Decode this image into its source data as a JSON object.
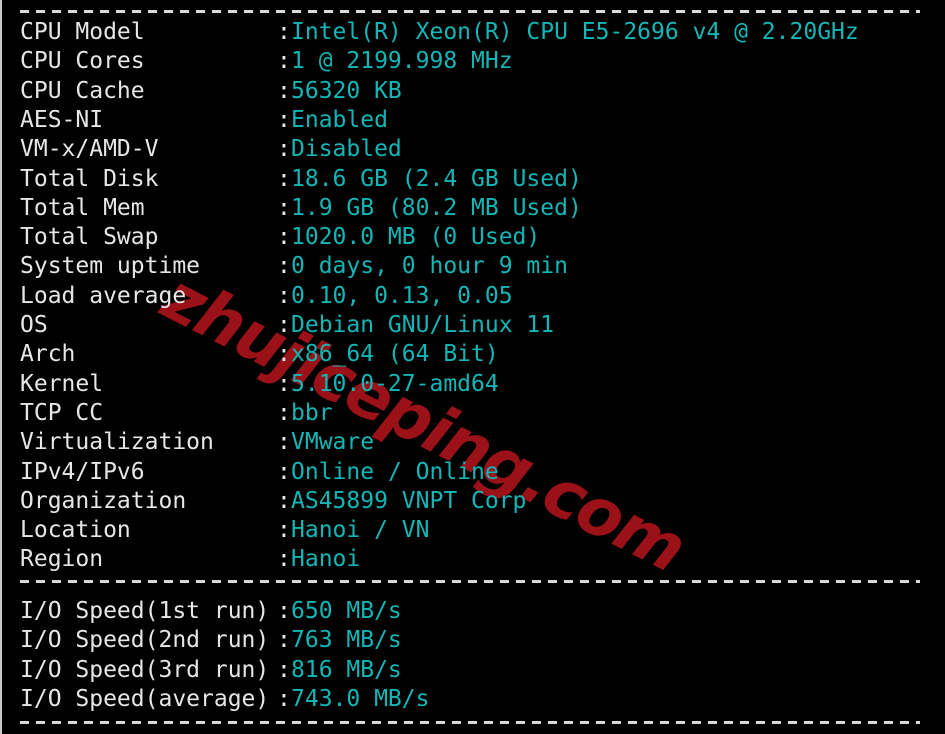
{
  "terminal": {
    "watermark": "zhujiceping.com",
    "separator": "------------------------------------------------",
    "colon": ":",
    "colors": {
      "background": "#000000",
      "label": "#e6e6e6",
      "cyan": "#13b6b6",
      "green": "#1a9e1a",
      "red": "#c41c21",
      "yellow": "#c9b32a",
      "watermark_red": "#9b1118"
    },
    "system_info": [
      {
        "label": "CPU Model",
        "value": "Intel(R) Xeon(R) CPU E5-2696 v4 @ 2.20GHz",
        "color": "cyan"
      },
      {
        "label": "CPU Cores",
        "value": "1 @ 2199.998 MHz",
        "color": "cyan"
      },
      {
        "label": "CPU Cache",
        "value": "56320 KB",
        "color": "cyan"
      },
      {
        "label": "AES-NI",
        "value": "Enabled",
        "color": "green"
      },
      {
        "label": "VM-x/AMD-V",
        "value": "Disabled",
        "color": "red"
      },
      {
        "label": "Total Disk",
        "value": "18.6 GB",
        "value2": " (2.4 GB Used)",
        "color": "yellow",
        "color2": "cyan"
      },
      {
        "label": "Total Mem",
        "value": "1.9 GB",
        "value2": " (80.2 MB Used)",
        "color": "yellow",
        "color2": "cyan"
      },
      {
        "label": "Total Swap",
        "value": "1020.0 MB (0 Used)",
        "color": "cyan"
      },
      {
        "label": "System uptime",
        "value": "0 days, 0 hour 9 min",
        "color": "cyan"
      },
      {
        "label": "Load average",
        "value": "0.10, 0.13, 0.05",
        "color": "cyan"
      },
      {
        "label": "OS",
        "value": "Debian GNU/Linux 11",
        "color": "cyan"
      },
      {
        "label": "Arch",
        "value": "x86_64 (64 Bit)",
        "color": "cyan"
      },
      {
        "label": "Kernel",
        "value": "5.10.0-27-amd64",
        "color": "cyan"
      },
      {
        "label": "TCP CC",
        "value": "bbr",
        "color": "yellow"
      },
      {
        "label": "Virtualization",
        "value": "VMware",
        "color": "cyan"
      },
      {
        "label": "IPv4/IPv6",
        "value": "Online",
        "value2": " / ",
        "value3": "Online",
        "color": "green",
        "color2": "cyan",
        "color3": "green"
      },
      {
        "label": "Organization",
        "value": "AS45899 VNPT Corp",
        "color": "cyan"
      },
      {
        "label": "Location",
        "value": "Hanoi / VN",
        "color": "cyan"
      },
      {
        "label": "Region",
        "value": "Hanoi",
        "color": "yellow"
      }
    ],
    "io_speed": [
      {
        "label": "I/O Speed(1st run)",
        "value": "650 MB/s",
        "color": "yellow"
      },
      {
        "label": "I/O Speed(2nd run)",
        "value": "763 MB/s",
        "color": "yellow"
      },
      {
        "label": "I/O Speed(3rd run)",
        "value": "816 MB/s",
        "color": "yellow"
      },
      {
        "label": "I/O Speed(average)",
        "value": "743.0 MB/s",
        "color": "yellow"
      }
    ]
  }
}
